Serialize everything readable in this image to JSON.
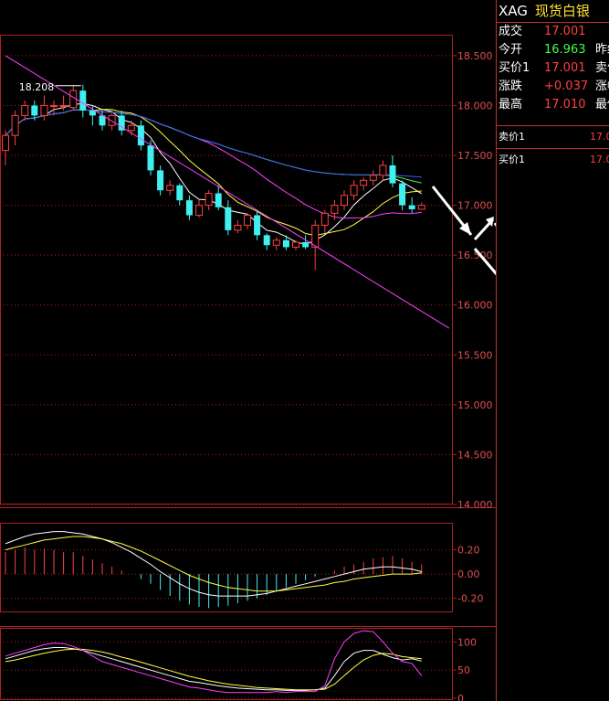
{
  "colors": {
    "up": "#ff4040",
    "down": "#40f0f0",
    "grid": "#b02020",
    "axis_text": "#e05050",
    "ma5": "#ffffff",
    "ma10": "#ffff40",
    "ma20": "#ff40ff",
    "ma60": "#40ff40",
    "ma120": "#4060ff",
    "ma250": "#c0c0c0",
    "trendline": "#ff40ff",
    "arrows": "#ffffff"
  },
  "chart_data": [
    {
      "type": "candlestick",
      "panel": "price",
      "ylim": [
        14.0,
        18.6
      ],
      "yticks": [
        "18.500",
        "18.000",
        "17.500",
        "17.000",
        "16.500",
        "16.000",
        "15.500",
        "15.000",
        "14.500",
        "14.000"
      ],
      "annotation": {
        "text": "18.208",
        "value": 18.208,
        "bar": 8
      },
      "candles": [
        [
          17.55,
          17.75,
          17.4,
          17.7
        ],
        [
          17.7,
          17.95,
          17.6,
          17.9
        ],
        [
          17.9,
          18.05,
          17.85,
          18.0
        ],
        [
          18.0,
          18.05,
          17.85,
          17.9
        ],
        [
          17.9,
          18.1,
          17.85,
          18.0
        ],
        [
          18.0,
          18.05,
          17.9,
          18.0
        ],
        [
          18.0,
          18.1,
          17.95,
          18.0
        ],
        [
          17.98,
          18.2,
          17.95,
          18.15
        ],
        [
          18.15,
          18.21,
          17.88,
          17.95
        ],
        [
          17.95,
          18.0,
          17.8,
          17.9
        ],
        [
          17.9,
          17.95,
          17.75,
          17.8
        ],
        [
          17.8,
          17.92,
          17.75,
          17.9
        ],
        [
          17.9,
          17.95,
          17.7,
          17.75
        ],
        [
          17.75,
          17.85,
          17.7,
          17.8
        ],
        [
          17.8,
          17.85,
          17.55,
          17.6
        ],
        [
          17.6,
          17.65,
          17.3,
          17.35
        ],
        [
          17.35,
          17.4,
          17.1,
          17.15
        ],
        [
          17.15,
          17.25,
          17.1,
          17.2
        ],
        [
          17.2,
          17.22,
          17.0,
          17.05
        ],
        [
          17.05,
          17.1,
          16.85,
          16.9
        ],
        [
          16.9,
          17.05,
          16.88,
          17.0
        ],
        [
          17.0,
          17.15,
          16.95,
          17.12
        ],
        [
          17.12,
          17.2,
          16.95,
          16.98
        ],
        [
          16.98,
          17.05,
          16.7,
          16.75
        ],
        [
          16.75,
          16.85,
          16.72,
          16.8
        ],
        [
          16.8,
          16.92,
          16.76,
          16.9
        ],
        [
          16.9,
          16.95,
          16.65,
          16.7
        ],
        [
          16.7,
          16.72,
          16.55,
          16.6
        ],
        [
          16.6,
          16.68,
          16.55,
          16.65
        ],
        [
          16.65,
          16.7,
          16.55,
          16.58
        ],
        [
          16.58,
          16.65,
          16.55,
          16.63
        ],
        [
          16.63,
          16.7,
          16.56,
          16.58
        ],
        [
          16.58,
          16.85,
          16.35,
          16.8
        ],
        [
          16.8,
          16.95,
          16.72,
          16.92
        ],
        [
          16.92,
          17.05,
          16.85,
          17.0
        ],
        [
          17.0,
          17.15,
          16.95,
          17.1
        ],
        [
          17.1,
          17.25,
          17.05,
          17.2
        ],
        [
          17.2,
          17.28,
          17.15,
          17.25
        ],
        [
          17.25,
          17.35,
          17.2,
          17.3
        ],
        [
          17.3,
          17.45,
          17.25,
          17.4
        ],
        [
          17.4,
          17.5,
          17.18,
          17.22
        ],
        [
          17.22,
          17.25,
          16.95,
          17.0
        ],
        [
          17.0,
          17.08,
          16.92,
          16.96
        ],
        [
          16.96,
          17.03,
          16.96,
          17.0
        ]
      ],
      "trendline": [
        [
          0,
          18.5
        ],
        [
          43,
          15.75
        ]
      ]
    },
    {
      "type": "macd",
      "panel": "macd",
      "ylim": [
        -0.3,
        0.4
      ],
      "yticks": [
        "0.20",
        "0.00",
        "-0.20"
      ],
      "histogram": [
        0.18,
        0.2,
        0.22,
        0.2,
        0.21,
        0.2,
        0.18,
        0.18,
        0.15,
        0.12,
        0.09,
        0.06,
        0.03,
        0.0,
        -0.04,
        -0.08,
        -0.13,
        -0.18,
        -0.22,
        -0.25,
        -0.27,
        -0.28,
        -0.27,
        -0.26,
        -0.24,
        -0.22,
        -0.2,
        -0.17,
        -0.14,
        -0.11,
        -0.08,
        -0.05,
        -0.02,
        0.0,
        0.03,
        0.06,
        0.08,
        0.1,
        0.13,
        0.14,
        0.15,
        0.13,
        0.1,
        0.08
      ],
      "dif": [
        0.25,
        0.28,
        0.31,
        0.33,
        0.34,
        0.35,
        0.35,
        0.34,
        0.33,
        0.31,
        0.29,
        0.26,
        0.22,
        0.18,
        0.13,
        0.08,
        0.02,
        -0.03,
        -0.08,
        -0.12,
        -0.15,
        -0.17,
        -0.18,
        -0.18,
        -0.18,
        -0.18,
        -0.17,
        -0.16,
        -0.14,
        -0.12,
        -0.1,
        -0.08,
        -0.06,
        -0.04,
        -0.02,
        0.0,
        0.02,
        0.04,
        0.05,
        0.06,
        0.06,
        0.05,
        0.04,
        0.02
      ],
      "dea": [
        0.2,
        0.22,
        0.24,
        0.26,
        0.28,
        0.29,
        0.3,
        0.31,
        0.31,
        0.3,
        0.29,
        0.27,
        0.25,
        0.22,
        0.19,
        0.15,
        0.11,
        0.07,
        0.03,
        -0.01,
        -0.04,
        -0.07,
        -0.09,
        -0.11,
        -0.12,
        -0.13,
        -0.14,
        -0.14,
        -0.14,
        -0.13,
        -0.12,
        -0.11,
        -0.1,
        -0.09,
        -0.07,
        -0.06,
        -0.04,
        -0.03,
        -0.02,
        -0.01,
        0.0,
        0.0,
        0.0,
        0.01
      ]
    },
    {
      "type": "kdj",
      "panel": "kdj",
      "ylim": [
        0,
        120
      ],
      "yticks": [
        "100",
        "50",
        "0"
      ],
      "k": [
        70,
        75,
        80,
        85,
        88,
        90,
        90,
        88,
        85,
        80,
        75,
        70,
        65,
        60,
        55,
        50,
        45,
        40,
        35,
        30,
        28,
        25,
        22,
        20,
        18,
        17,
        16,
        15,
        15,
        14,
        14,
        14,
        15,
        18,
        40,
        65,
        80,
        85,
        85,
        78,
        72,
        68,
        70,
        66
      ],
      "d": [
        65,
        68,
        72,
        76,
        80,
        83,
        86,
        87,
        87,
        85,
        82,
        78,
        73,
        69,
        64,
        59,
        54,
        49,
        44,
        39,
        35,
        31,
        28,
        25,
        23,
        21,
        19,
        18,
        17,
        16,
        15,
        15,
        15,
        16,
        25,
        40,
        55,
        68,
        76,
        80,
        78,
        74,
        72,
        70
      ],
      "j": [
        75,
        80,
        85,
        90,
        95,
        98,
        97,
        92,
        85,
        75,
        65,
        60,
        55,
        50,
        45,
        40,
        35,
        30,
        25,
        20,
        18,
        15,
        12,
        10,
        10,
        10,
        10,
        10,
        12,
        10,
        12,
        12,
        12,
        22,
        70,
        100,
        115,
        120,
        118,
        100,
        80,
        65,
        62,
        40
      ]
    }
  ],
  "panel": {
    "symbol": "XAG",
    "name": "现货白银",
    "rows": [
      {
        "label": "成交",
        "value": "17.001",
        "color": "#ff4040",
        "label2": ""
      },
      {
        "label": "今开",
        "value": "16.963",
        "color": "#40ff40",
        "label2": "昨结"
      },
      {
        "label": "买价1",
        "value": "17.001",
        "color": "#ff4040",
        "label2": "卖价"
      },
      {
        "label": "涨跌",
        "value": "+0.037",
        "color": "#ff4040",
        "label2": "涨幅"
      },
      {
        "label": "最高",
        "value": "17.010",
        "color": "#ff4040",
        "label2": "最低"
      }
    ],
    "book": [
      {
        "label": "卖价1",
        "value": "17.0"
      },
      {
        "label": "买价1",
        "value": "17.0"
      }
    ]
  }
}
